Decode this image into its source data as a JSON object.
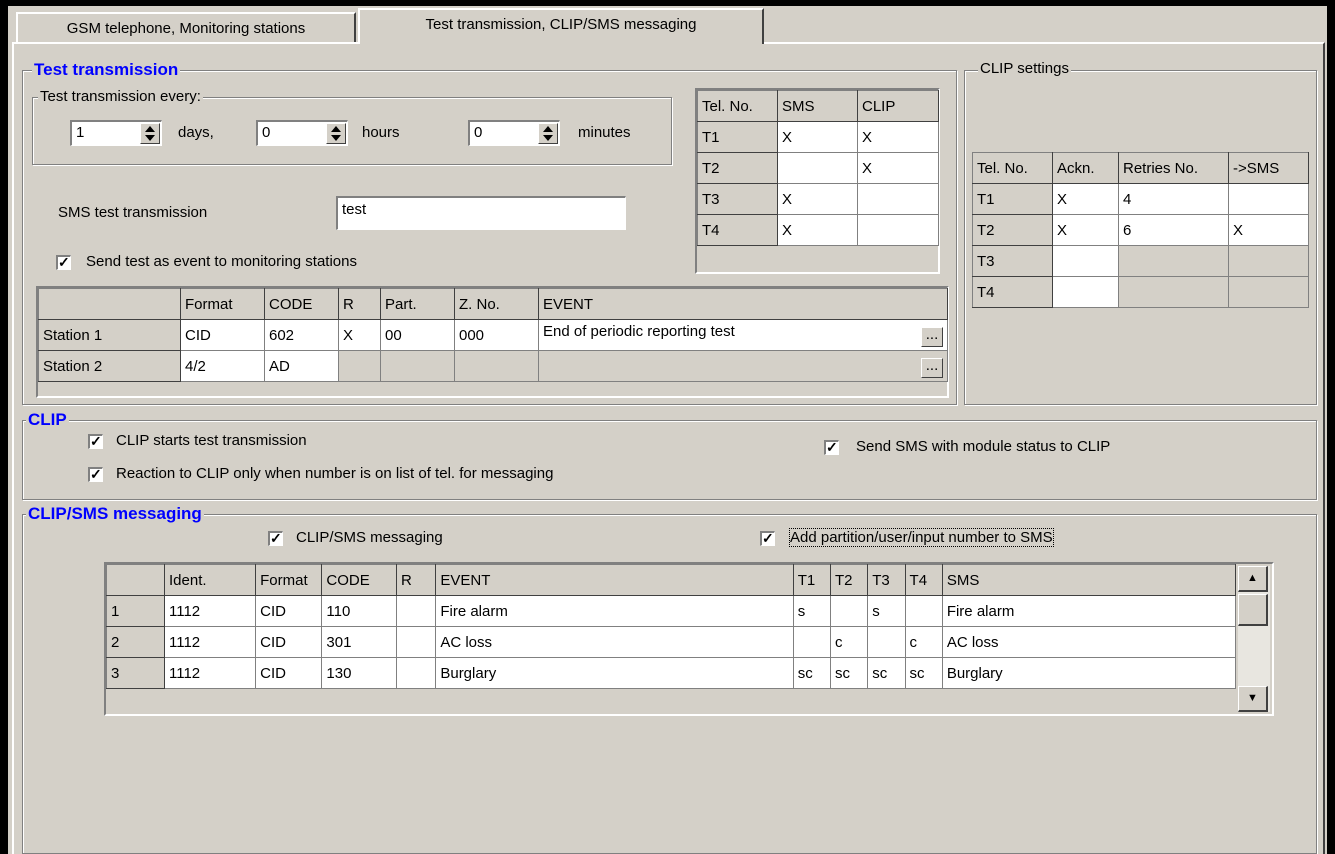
{
  "tabs": [
    {
      "label": "GSM telephone, Monitoring stations"
    },
    {
      "label": "Test transmission,  CLIP/SMS messaging"
    }
  ],
  "test_transmission": {
    "title": "Test transmission",
    "every_group": "Test transmission every:",
    "days_value": "1",
    "days_label": "days,",
    "hours_value": "0",
    "hours_label": "hours",
    "minutes_value": "0",
    "minutes_label": "minutes",
    "sms_label": "SMS test transmission",
    "sms_value": "test",
    "send_event_label": "Send test as event to monitoring stations",
    "tel_table": {
      "headers": [
        "Tel. No.",
        "SMS",
        "CLIP"
      ],
      "rows": [
        [
          "T1",
          "X",
          "X"
        ],
        [
          "T2",
          "",
          "X"
        ],
        [
          "T3",
          "X",
          ""
        ],
        [
          "T4",
          "X",
          ""
        ]
      ]
    },
    "stations_table": {
      "headers": [
        "",
        "Format",
        "CODE",
        "R",
        "Part.",
        "Z. No.",
        "EVENT"
      ],
      "rows": [
        [
          "Station 1",
          "CID",
          "602",
          "X",
          "00",
          "000",
          "End of periodic reporting test"
        ],
        [
          "Station 2",
          "4/2",
          "AD",
          "",
          "",
          "",
          ""
        ]
      ],
      "ellipsis": "..."
    }
  },
  "clip_settings": {
    "title": "CLIP settings",
    "headers": [
      "Tel. No.",
      "Ackn.",
      "Retries No.",
      "->SMS"
    ],
    "rows": [
      [
        "T1",
        "X",
        "4",
        ""
      ],
      [
        "T2",
        "X",
        "6",
        "X"
      ],
      [
        "T3",
        "",
        "",
        ""
      ],
      [
        "T4",
        "",
        "",
        ""
      ]
    ]
  },
  "clip": {
    "title": "CLIP",
    "starts_test": "CLIP starts test transmission",
    "reaction_only": "Reaction to CLIP only when number is on list of tel. for messaging",
    "send_sms_status": "Send SMS with module status to CLIP"
  },
  "messaging": {
    "title": "CLIP/SMS messaging",
    "enable_label": "CLIP/SMS messaging",
    "add_number_label": "Add partition/user/input number to SMS",
    "headers": [
      "",
      "Ident.",
      "Format",
      "CODE",
      "R",
      "EVENT",
      "T1",
      "T2",
      "T3",
      "T4",
      "SMS"
    ],
    "rows": [
      [
        "1",
        "1112",
        "CID",
        "110",
        "",
        "Fire alarm",
        "s",
        "",
        "s",
        "",
        "Fire alarm"
      ],
      [
        "2",
        "1112",
        "CID",
        "301",
        "",
        "AC loss",
        "",
        "c",
        "",
        "c",
        "AC loss"
      ],
      [
        "3",
        "1112",
        "CID",
        "130",
        "",
        "Burglary",
        "sc",
        "sc",
        "sc",
        "sc",
        "Burglary"
      ]
    ]
  },
  "icons": {
    "spin": "spin-updown-icon",
    "check": "checkmark-icon",
    "scroll_up": "scroll-up-icon",
    "scroll_down": "scroll-down-icon"
  }
}
